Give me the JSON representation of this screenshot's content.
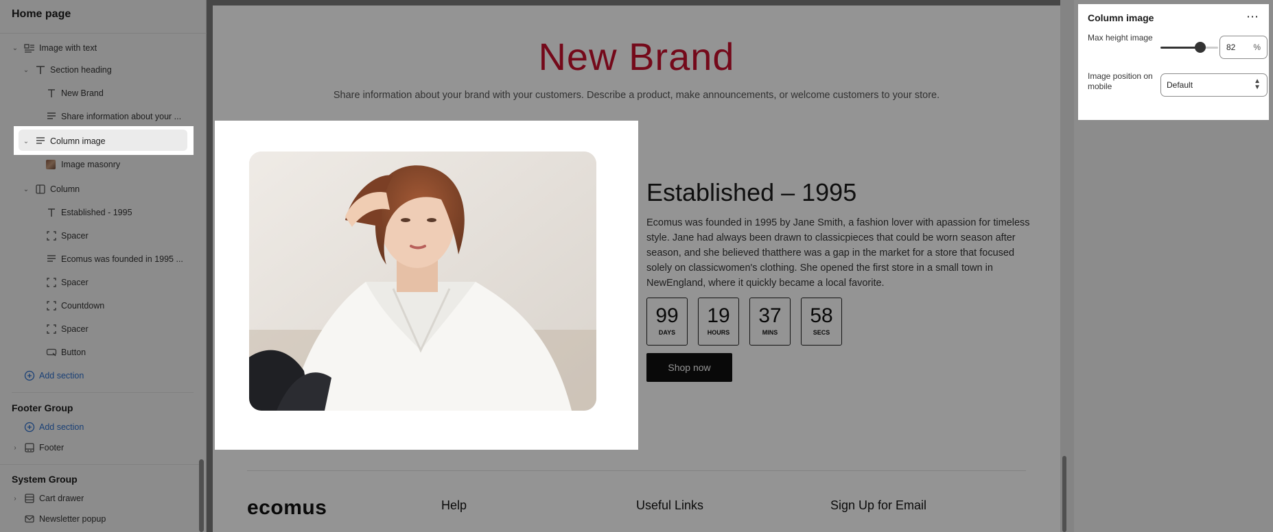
{
  "sidebar": {
    "title": "Home page",
    "tree": [
      {
        "label": "Image with text",
        "icon": "image-with-text-icon",
        "expanded": true
      },
      {
        "label": "Section heading",
        "icon": "text-icon",
        "expanded": true
      },
      {
        "label": "New Brand",
        "icon": "text-icon"
      },
      {
        "label": "Share information about your ...",
        "icon": "paragraph-icon"
      },
      {
        "label": "Column image",
        "icon": "paragraph-icon",
        "expanded": true,
        "selected": true
      },
      {
        "label": "Image masonry",
        "icon": "image-thumb-icon"
      },
      {
        "label": "Column",
        "icon": "column-icon",
        "expanded": true
      },
      {
        "label": "Established - 1995",
        "icon": "text-icon"
      },
      {
        "label": "Spacer",
        "icon": "spacer-icon"
      },
      {
        "label": "Ecomus was founded in 1995 ...",
        "icon": "paragraph-icon"
      },
      {
        "label": "Spacer",
        "icon": "spacer-icon"
      },
      {
        "label": "Countdown",
        "icon": "spacer-icon"
      },
      {
        "label": "Spacer",
        "icon": "spacer-icon"
      },
      {
        "label": "Button",
        "icon": "button-icon"
      }
    ],
    "add_section_label": "Add section",
    "footer_group": {
      "title": "Footer Group",
      "add_section_label": "Add section",
      "footer_label": "Footer"
    },
    "system_group": {
      "title": "System Group",
      "cart_drawer_label": "Cart drawer",
      "newsletter_label": "Newsletter popup"
    }
  },
  "canvas": {
    "brand_title": "New Brand",
    "brand_subtitle": "Share information about your brand with your customers. Describe a product, make announcements, or welcome customers to your store.",
    "established_title": "Established – 1995",
    "established_body": "Ecomus was founded in 1995 by Jane Smith, a fashion lover with apassion for timeless style. Jane had always been drawn to classicpieces that could be worn season after season, and she believed thatthere was a gap in the market for a store that focused solely on classicwomen's clothing. She opened the first store in a small town in NewEngland, where it quickly became a local favorite.",
    "countdown": [
      {
        "value": "99",
        "unit": "DAYS"
      },
      {
        "value": "19",
        "unit": "HOURS"
      },
      {
        "value": "37",
        "unit": "MINS"
      },
      {
        "value": "58",
        "unit": "SECS"
      }
    ],
    "shop_button": "Shop now",
    "footer": {
      "logo": "ecomus",
      "col1": "Help",
      "col2": "Useful Links",
      "col3": "Sign Up for Email"
    }
  },
  "settings": {
    "title": "Column image",
    "more_icon": "⋯",
    "max_height_label": "Max height image",
    "max_height_value": "82",
    "max_height_unit": "%",
    "position_label": "Image position on mobile",
    "position_value": "Default"
  },
  "colors": {
    "brand_red": "#c8102e",
    "link_blue": "#2c6ecb"
  }
}
